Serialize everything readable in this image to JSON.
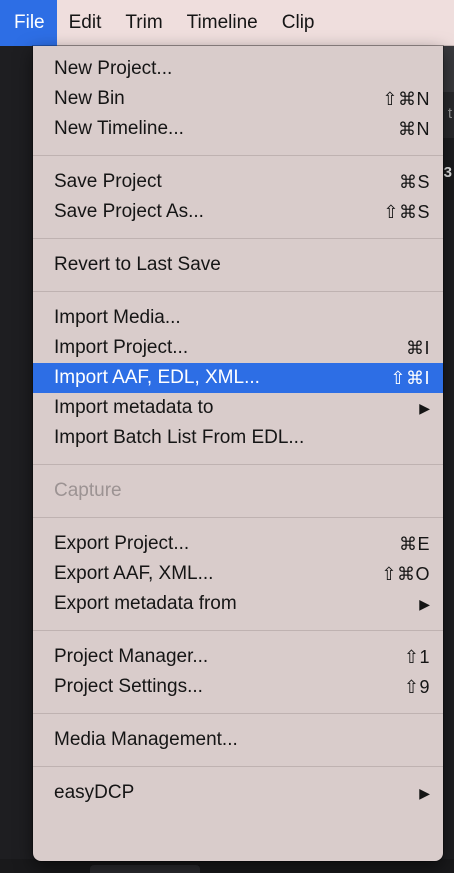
{
  "menubar": {
    "items": [
      {
        "label": "File"
      },
      {
        "label": "Edit"
      },
      {
        "label": "Trim"
      },
      {
        "label": "Timeline"
      },
      {
        "label": "Clip"
      }
    ]
  },
  "background": {
    "glyph_1": "t",
    "glyph_2": "3"
  },
  "file_menu": {
    "group1": {
      "new_project": {
        "label": "New Project..."
      },
      "new_bin": {
        "label": "New Bin",
        "shortcut": "⇧⌘N"
      },
      "new_timeline": {
        "label": "New Timeline...",
        "shortcut": "⌘N"
      }
    },
    "group2": {
      "save_project": {
        "label": "Save Project",
        "shortcut": "⌘S"
      },
      "save_project_as": {
        "label": "Save Project As...",
        "shortcut": "⇧⌘S"
      }
    },
    "group3": {
      "revert": {
        "label": "Revert to Last Save"
      }
    },
    "group4": {
      "import_media": {
        "label": "Import Media..."
      },
      "import_project": {
        "label": "Import Project...",
        "shortcut": "⌘I"
      },
      "import_aaf": {
        "label": "Import AAF, EDL, XML...",
        "shortcut": "⇧⌘I"
      },
      "import_metadata": {
        "label": "Import metadata to",
        "submenu_arrow": "▶"
      },
      "import_batch": {
        "label": "Import Batch List From EDL..."
      }
    },
    "group5": {
      "capture": {
        "label": "Capture"
      }
    },
    "group6": {
      "export_project": {
        "label": "Export Project...",
        "shortcut": "⌘E"
      },
      "export_aaf": {
        "label": "Export AAF, XML...",
        "shortcut": "⇧⌘O"
      },
      "export_metadata": {
        "label": "Export metadata from",
        "submenu_arrow": "▶"
      }
    },
    "group7": {
      "project_manager": {
        "label": "Project Manager...",
        "shortcut": "⇧1"
      },
      "project_settings": {
        "label": "Project Settings...",
        "shortcut": "⇧9"
      }
    },
    "group8": {
      "media_management": {
        "label": "Media Management..."
      }
    },
    "group9": {
      "easydcp": {
        "label": "easyDCP",
        "submenu_arrow": "▶"
      }
    }
  },
  "colors": {
    "menubar_bg": "#efdedd",
    "menu_bg": "#d9cccb",
    "highlight": "#2d6ee5",
    "disabled_text": "#9c9393",
    "app_bg": "#1e1e21"
  }
}
